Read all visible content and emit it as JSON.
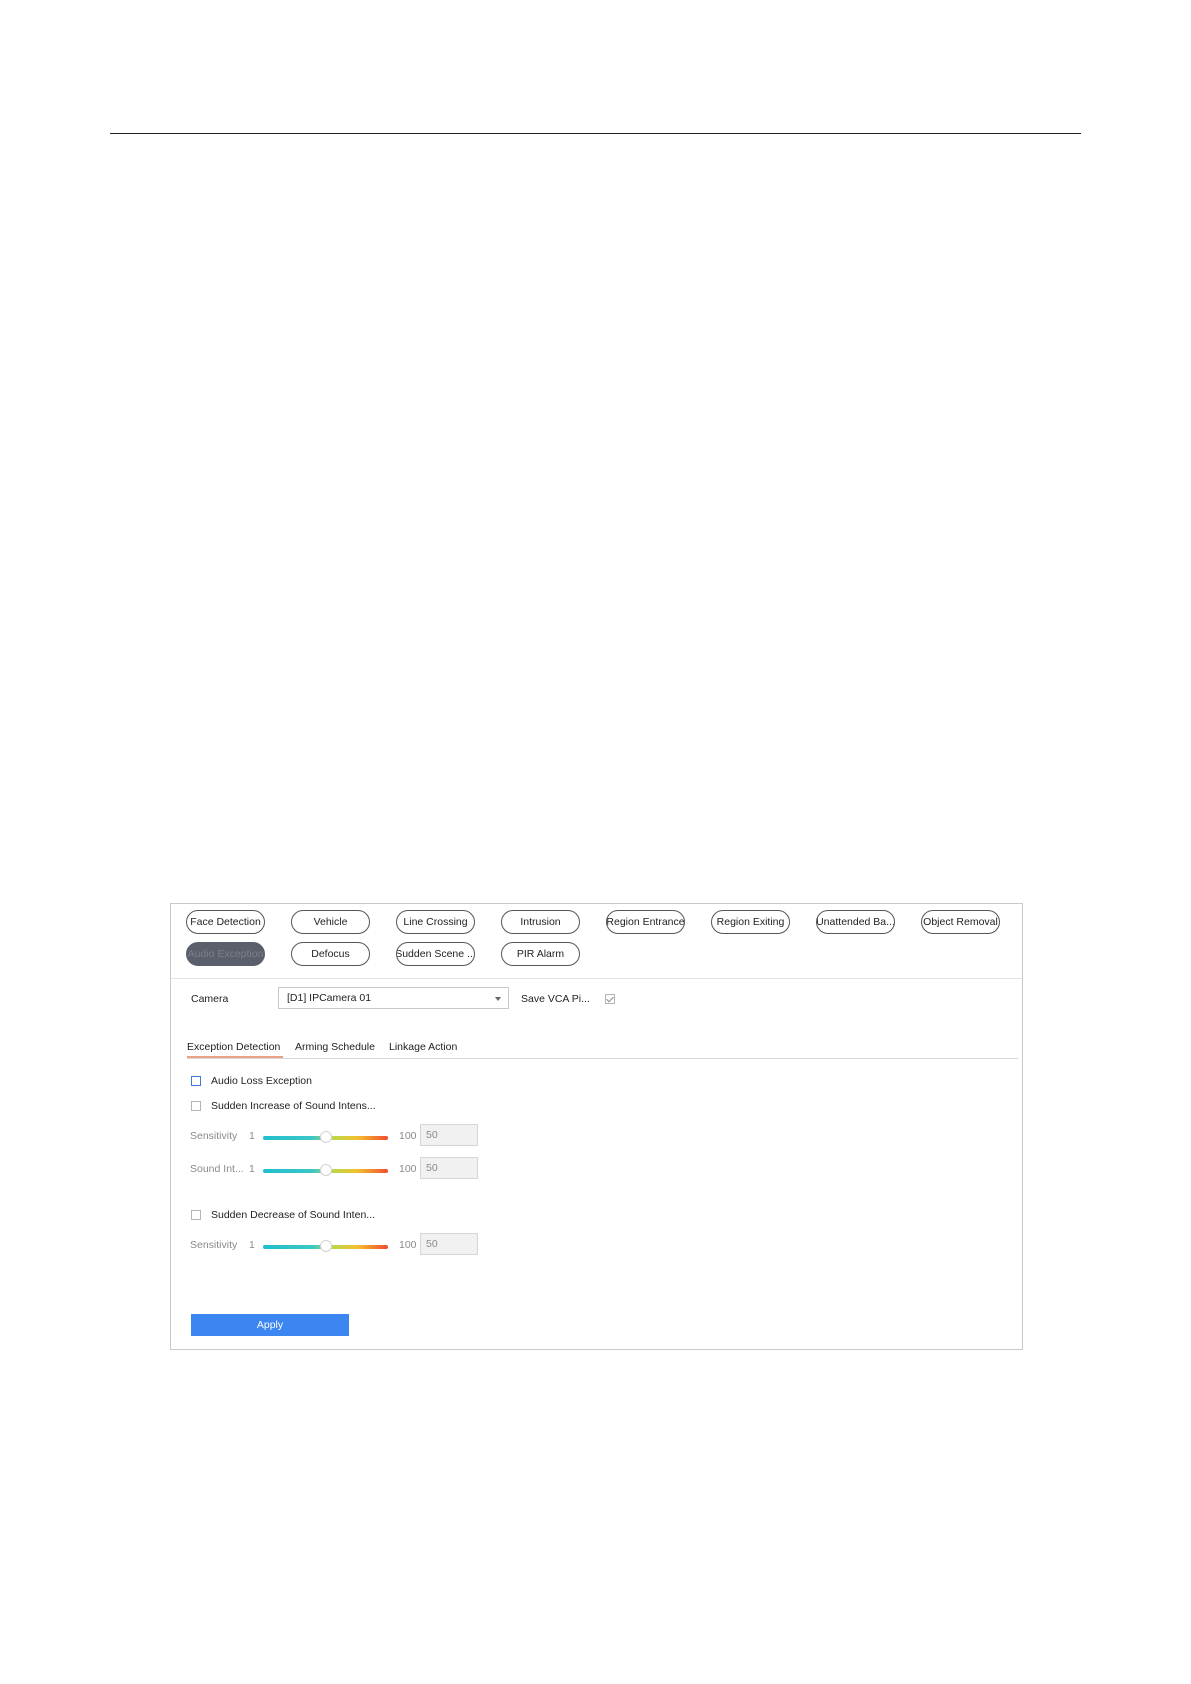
{
  "detection_types": [
    {
      "label": "Face Detection",
      "active": false
    },
    {
      "label": "Vehicle",
      "active": false
    },
    {
      "label": "Line Crossing",
      "active": false
    },
    {
      "label": "Intrusion",
      "active": false
    },
    {
      "label": "Region Entrance",
      "active": false
    },
    {
      "label": "Region Exiting",
      "active": false
    },
    {
      "label": "Unattended Ba...",
      "active": false
    },
    {
      "label": "Object Removal",
      "active": false
    },
    {
      "label": "Audio Exception",
      "active": true
    },
    {
      "label": "Defocus",
      "active": false
    },
    {
      "label": "Sudden Scene ...",
      "active": false
    },
    {
      "label": "PIR Alarm",
      "active": false
    }
  ],
  "camera": {
    "label": "Camera",
    "selected": "[D1] IPCamera 01"
  },
  "save_vca": {
    "label": "Save VCA Pi...",
    "checked": true
  },
  "tabs": [
    {
      "label": "Exception Detection",
      "active": true
    },
    {
      "label": "Arming Schedule",
      "active": false
    },
    {
      "label": "Linkage Action",
      "active": false
    }
  ],
  "options": {
    "audio_loss": {
      "label": "Audio Loss Exception",
      "checked": false
    },
    "sudden_increase": {
      "label": "Sudden Increase of Sound Intens...",
      "checked": false,
      "sliders": [
        {
          "label": "Sensitivity",
          "min": "1",
          "max": "100",
          "value": "50",
          "level": 0.5
        },
        {
          "label": "Sound Int...",
          "min": "1",
          "max": "100",
          "value": "50",
          "level": 0.5
        }
      ]
    },
    "sudden_decrease": {
      "label": "Sudden Decrease of Sound Inten...",
      "checked": false,
      "sliders": [
        {
          "label": "Sensitivity",
          "min": "1",
          "max": "100",
          "value": "50",
          "level": 0.5
        }
      ]
    }
  },
  "apply_label": "Apply"
}
